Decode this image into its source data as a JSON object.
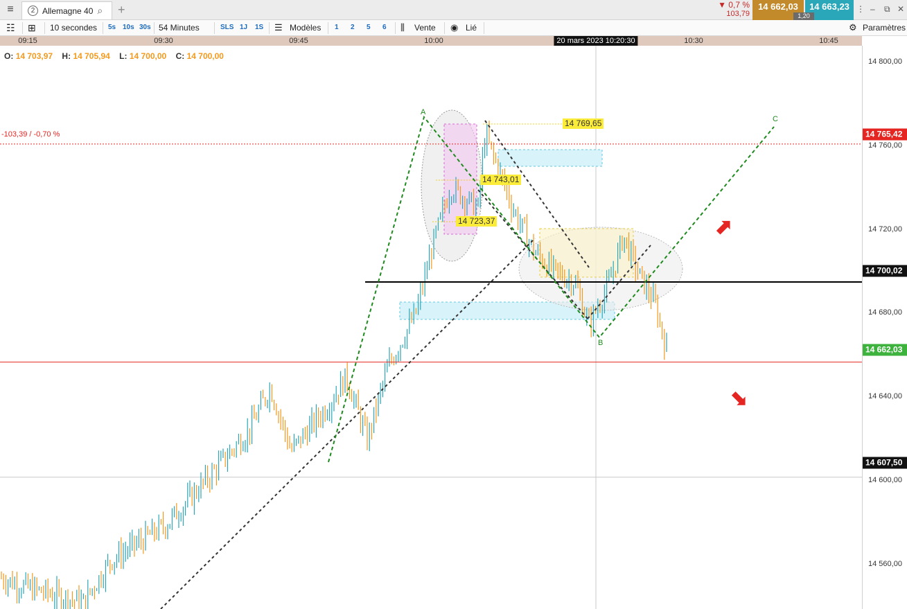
{
  "tab": {
    "number": "2",
    "name": "Allemagne 40"
  },
  "quote": {
    "change_pct": "▼ 0,7 %",
    "change_abs": "103,79",
    "sell": "14 662,03",
    "buy": "14 663,23",
    "spread": "1,20"
  },
  "toolbar": {
    "interval": "10 secondes",
    "quick_intervals": [
      "5s",
      "10s",
      "30s"
    ],
    "duration": "54 Minutes",
    "ranges": [
      "SLS",
      "1J",
      "1S"
    ],
    "templates": "Modèles",
    "layouts": [
      "1",
      "2",
      "5",
      "6"
    ],
    "side": "Vente",
    "link": "Lié",
    "settings": "Paramètres"
  },
  "time_axis": {
    "labels": [
      "09:15",
      "09:30",
      "09:45",
      "10:00",
      "10:30",
      "10:45"
    ],
    "cursor": "20 mars 2023 10:20:30"
  },
  "ohlc": {
    "o_label": "O:",
    "o": "14 703,97",
    "h_label": "H:",
    "h": "14 705,94",
    "l_label": "L:",
    "l": "14 700,00",
    "c_label": "C:",
    "c": "14 700,00"
  },
  "annotations": {
    "change": "-103,39 / -0,70 %",
    "level_high": "14 769,65",
    "level_mid": "14 743,01",
    "level_low": "14 723,37",
    "wave_a": "A",
    "wave_b": "B",
    "wave_c": "C"
  },
  "price_axis": {
    "labels": [
      "14 800,00",
      "14 760,00",
      "14 720,00",
      "14 680,00",
      "14 640,00",
      "14 600,00",
      "14 560,00"
    ],
    "tag_prev_close": "14 765,42",
    "tag_hline": "14 700,02",
    "tag_last": "14 662,03",
    "tag_cursor": "14 607,50"
  },
  "chart_data": {
    "type": "bar",
    "ylim": [
      14545,
      14812
    ],
    "prev_close": 14765.42,
    "hline": 14700.02,
    "last": 14662.03,
    "cursor_price": 14607.5,
    "colors": {
      "up": "#2aa7b8",
      "down": "#f39a1e",
      "prev_close": "#e52521",
      "last": "#e52521",
      "wave": "#1e8a1e",
      "channel": "#333333"
    }
  }
}
